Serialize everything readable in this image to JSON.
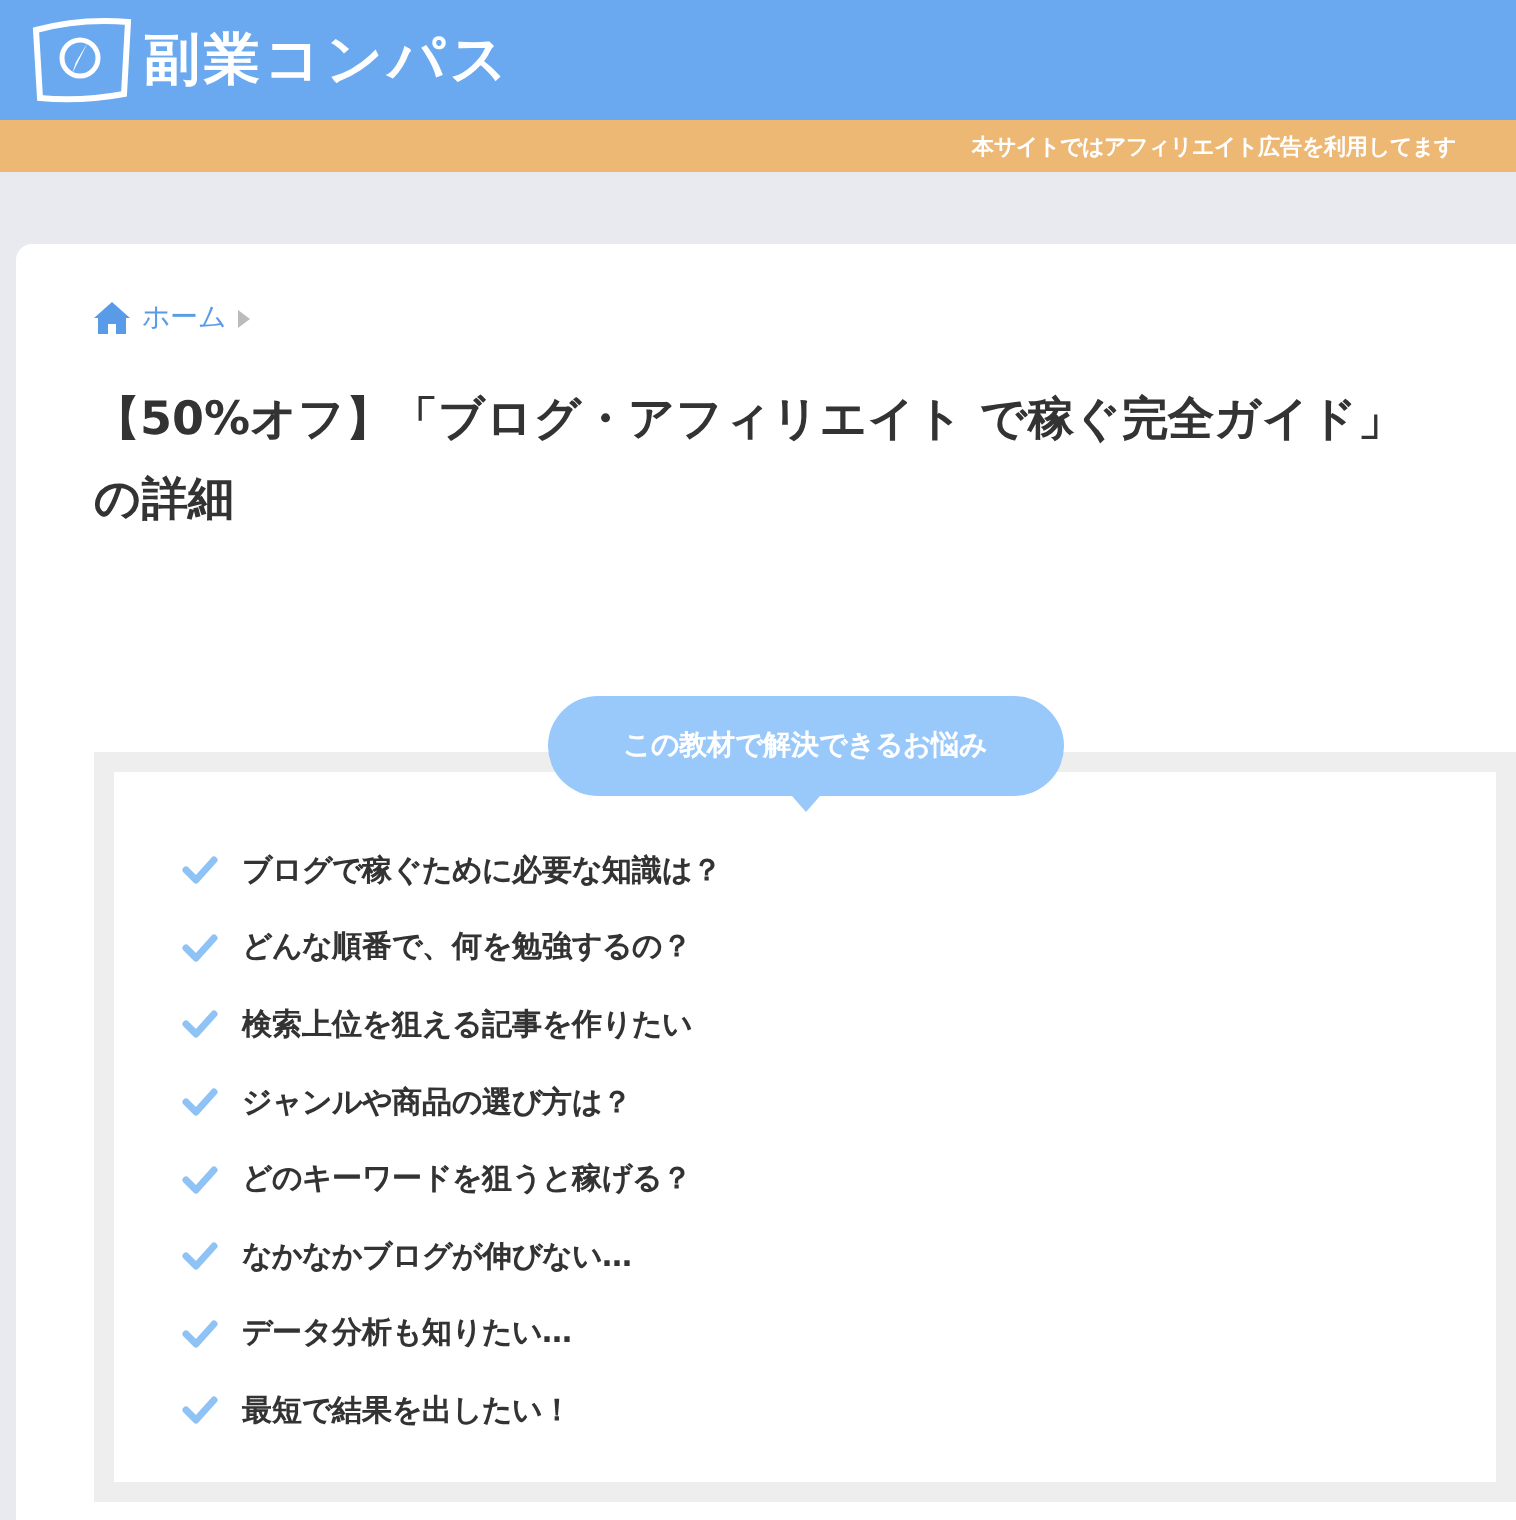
{
  "header": {
    "site_name": "副業コンパス",
    "notice": "本サイトではアフィリエイト広告を利用してます"
  },
  "breadcrumb": {
    "items": [
      "ホーム"
    ]
  },
  "title": "【50%オフ】「ブログ・アフィリエイト で稼ぐ完全ガイド」の詳細",
  "problems": {
    "heading": "この教材で解決できるお悩み",
    "items": [
      "ブログで稼ぐために必要な知識は？",
      "どんな順番で、何を勉強するの？",
      "検索上位を狙える記事を作りたい",
      "ジャンルや商品の選び方は？",
      "どのキーワードを狙うと稼げる？",
      "なかなかブログが伸びない…",
      "データ分析も知りたい…",
      "最短で結果を出したい！"
    ]
  }
}
